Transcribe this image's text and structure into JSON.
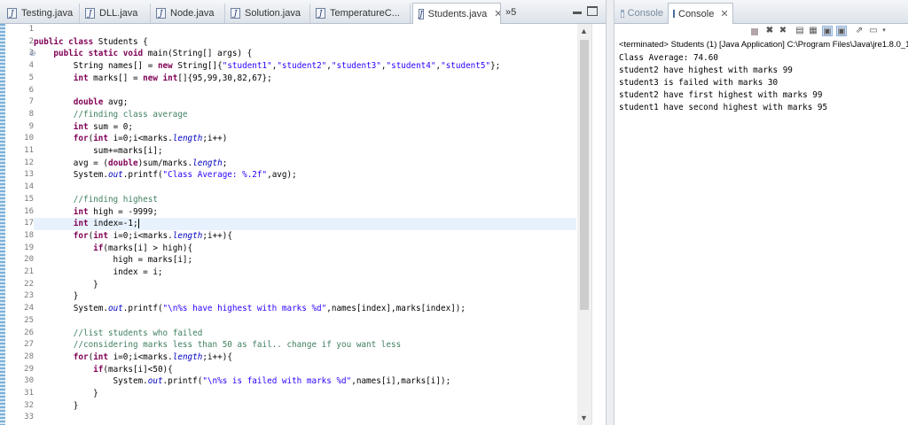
{
  "editor": {
    "tabs": [
      {
        "label": "Testing.java",
        "active": false
      },
      {
        "label": "DLL.java",
        "active": false
      },
      {
        "label": "Node.java",
        "active": false
      },
      {
        "label": "Solution.java",
        "active": false
      },
      {
        "label": "TemperatureC...",
        "active": false
      },
      {
        "label": "Students.java",
        "active": true
      }
    ],
    "overflow_label": "»5",
    "current_line": 17,
    "lines": [
      {
        "n": "1",
        "html": ""
      },
      {
        "n": "2",
        "html": "<span class=\"kw\">public class</span> Students {"
      },
      {
        "n": "3",
        "html": "    <span class=\"kw\">public static void</span> main(String[] args) {"
      },
      {
        "n": "4",
        "html": "        String names[] = <span class=\"kw\">new</span> String[]{<span class=\"str\">\"student1\"</span>,<span class=\"str\">\"student2\"</span>,<span class=\"str\">\"student3\"</span>,<span class=\"str\">\"student4\"</span>,<span class=\"str\">\"student5\"</span>};"
      },
      {
        "n": "5",
        "html": "        <span class=\"kw\">int</span> marks[] = <span class=\"kw\">new int</span>[]{95,99,30,82,67};"
      },
      {
        "n": "6",
        "html": ""
      },
      {
        "n": "7",
        "html": "        <span class=\"kw\">double</span> avg;"
      },
      {
        "n": "8",
        "html": "        <span class=\"cm\">//finding class average</span>"
      },
      {
        "n": "9",
        "html": "        <span class=\"kw\">int</span> sum = 0;"
      },
      {
        "n": "10",
        "html": "        <span class=\"kw\">for</span>(<span class=\"kw\">int</span> i=0;i&lt;marks.<span class=\"fld\">length</span>;i++)"
      },
      {
        "n": "11",
        "html": "            sum+=marks[i];"
      },
      {
        "n": "12",
        "html": "        avg = (<span class=\"kw\">double</span>)sum/marks.<span class=\"fld\">length</span>;"
      },
      {
        "n": "13",
        "html": "        System.<span class=\"fld\">out</span>.printf(<span class=\"str\">\"Class Average: %.2f\"</span>,avg);"
      },
      {
        "n": "14",
        "html": ""
      },
      {
        "n": "15",
        "html": "        <span class=\"cm\">//finding highest</span>"
      },
      {
        "n": "16",
        "html": "        <span class=\"kw\">int</span> high = -9999;"
      },
      {
        "n": "17",
        "html": "        <span class=\"kw\">int</span> index=-1;<span class=\"caret\"></span>"
      },
      {
        "n": "18",
        "html": "        <span class=\"kw\">for</span>(<span class=\"kw\">int</span> i=0;i&lt;marks.<span class=\"fld\">length</span>;i++){"
      },
      {
        "n": "19",
        "html": "            <span class=\"kw\">if</span>(marks[i] &gt; high){"
      },
      {
        "n": "20",
        "html": "                high = marks[i];"
      },
      {
        "n": "21",
        "html": "                index = i;"
      },
      {
        "n": "22",
        "html": "            }"
      },
      {
        "n": "23",
        "html": "        }"
      },
      {
        "n": "24",
        "html": "        System.<span class=\"fld\">out</span>.printf(<span class=\"str\">\"\\n%s have highest with marks %d\"</span>,names[index],marks[index]);"
      },
      {
        "n": "25",
        "html": ""
      },
      {
        "n": "26",
        "html": "        <span class=\"cm\">//list students who failed</span>"
      },
      {
        "n": "27",
        "html": "        <span class=\"cm\">//considering marks less than 50 as fail.. change if you want less</span>"
      },
      {
        "n": "28",
        "html": "        <span class=\"kw\">for</span>(<span class=\"kw\">int</span> i=0;i&lt;marks.<span class=\"fld\">length</span>;i++){"
      },
      {
        "n": "29",
        "html": "            <span class=\"kw\">if</span>(marks[i]&lt;50){"
      },
      {
        "n": "30",
        "html": "                System.<span class=\"fld\">out</span>.printf(<span class=\"str\">\"\\n%s is failed with marks %d\"</span>,names[i],marks[i]);"
      },
      {
        "n": "31",
        "html": "            }"
      },
      {
        "n": "32",
        "html": "        }"
      },
      {
        "n": "33",
        "html": ""
      }
    ]
  },
  "console": {
    "tabs": [
      {
        "label": "Console",
        "active": false
      },
      {
        "label": "Console",
        "active": true
      }
    ],
    "status": "<terminated> Students (1) [Java Application] C:\\Program Files\\Java\\jre1.8.0_1",
    "output": [
      "Class Average: 74.60",
      "student2 have highest with marks 99",
      "student3 is failed with marks 30",
      "student2 have first highest with marks 99",
      "student1 have second highest with marks 95"
    ]
  }
}
